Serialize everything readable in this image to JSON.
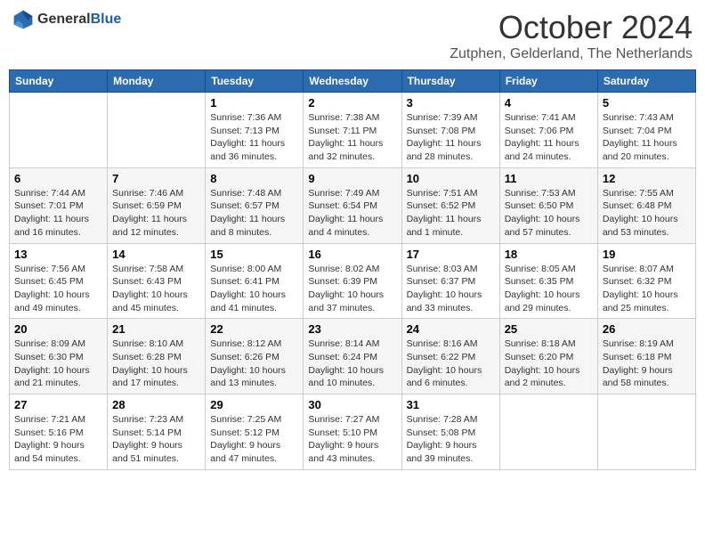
{
  "logo": {
    "general": "General",
    "blue": "Blue"
  },
  "header": {
    "month": "October 2024",
    "location": "Zutphen, Gelderland, The Netherlands"
  },
  "weekdays": [
    "Sunday",
    "Monday",
    "Tuesday",
    "Wednesday",
    "Thursday",
    "Friday",
    "Saturday"
  ],
  "weeks": [
    [
      {
        "day": "",
        "sunrise": "",
        "sunset": "",
        "daylight": ""
      },
      {
        "day": "",
        "sunrise": "",
        "sunset": "",
        "daylight": ""
      },
      {
        "day": "1",
        "sunrise": "Sunrise: 7:36 AM",
        "sunset": "Sunset: 7:13 PM",
        "daylight": "Daylight: 11 hours and 36 minutes."
      },
      {
        "day": "2",
        "sunrise": "Sunrise: 7:38 AM",
        "sunset": "Sunset: 7:11 PM",
        "daylight": "Daylight: 11 hours and 32 minutes."
      },
      {
        "day": "3",
        "sunrise": "Sunrise: 7:39 AM",
        "sunset": "Sunset: 7:08 PM",
        "daylight": "Daylight: 11 hours and 28 minutes."
      },
      {
        "day": "4",
        "sunrise": "Sunrise: 7:41 AM",
        "sunset": "Sunset: 7:06 PM",
        "daylight": "Daylight: 11 hours and 24 minutes."
      },
      {
        "day": "5",
        "sunrise": "Sunrise: 7:43 AM",
        "sunset": "Sunset: 7:04 PM",
        "daylight": "Daylight: 11 hours and 20 minutes."
      }
    ],
    [
      {
        "day": "6",
        "sunrise": "Sunrise: 7:44 AM",
        "sunset": "Sunset: 7:01 PM",
        "daylight": "Daylight: 11 hours and 16 minutes."
      },
      {
        "day": "7",
        "sunrise": "Sunrise: 7:46 AM",
        "sunset": "Sunset: 6:59 PM",
        "daylight": "Daylight: 11 hours and 12 minutes."
      },
      {
        "day": "8",
        "sunrise": "Sunrise: 7:48 AM",
        "sunset": "Sunset: 6:57 PM",
        "daylight": "Daylight: 11 hours and 8 minutes."
      },
      {
        "day": "9",
        "sunrise": "Sunrise: 7:49 AM",
        "sunset": "Sunset: 6:54 PM",
        "daylight": "Daylight: 11 hours and 4 minutes."
      },
      {
        "day": "10",
        "sunrise": "Sunrise: 7:51 AM",
        "sunset": "Sunset: 6:52 PM",
        "daylight": "Daylight: 11 hours and 1 minute."
      },
      {
        "day": "11",
        "sunrise": "Sunrise: 7:53 AM",
        "sunset": "Sunset: 6:50 PM",
        "daylight": "Daylight: 10 hours and 57 minutes."
      },
      {
        "day": "12",
        "sunrise": "Sunrise: 7:55 AM",
        "sunset": "Sunset: 6:48 PM",
        "daylight": "Daylight: 10 hours and 53 minutes."
      }
    ],
    [
      {
        "day": "13",
        "sunrise": "Sunrise: 7:56 AM",
        "sunset": "Sunset: 6:45 PM",
        "daylight": "Daylight: 10 hours and 49 minutes."
      },
      {
        "day": "14",
        "sunrise": "Sunrise: 7:58 AM",
        "sunset": "Sunset: 6:43 PM",
        "daylight": "Daylight: 10 hours and 45 minutes."
      },
      {
        "day": "15",
        "sunrise": "Sunrise: 8:00 AM",
        "sunset": "Sunset: 6:41 PM",
        "daylight": "Daylight: 10 hours and 41 minutes."
      },
      {
        "day": "16",
        "sunrise": "Sunrise: 8:02 AM",
        "sunset": "Sunset: 6:39 PM",
        "daylight": "Daylight: 10 hours and 37 minutes."
      },
      {
        "day": "17",
        "sunrise": "Sunrise: 8:03 AM",
        "sunset": "Sunset: 6:37 PM",
        "daylight": "Daylight: 10 hours and 33 minutes."
      },
      {
        "day": "18",
        "sunrise": "Sunrise: 8:05 AM",
        "sunset": "Sunset: 6:35 PM",
        "daylight": "Daylight: 10 hours and 29 minutes."
      },
      {
        "day": "19",
        "sunrise": "Sunrise: 8:07 AM",
        "sunset": "Sunset: 6:32 PM",
        "daylight": "Daylight: 10 hours and 25 minutes."
      }
    ],
    [
      {
        "day": "20",
        "sunrise": "Sunrise: 8:09 AM",
        "sunset": "Sunset: 6:30 PM",
        "daylight": "Daylight: 10 hours and 21 minutes."
      },
      {
        "day": "21",
        "sunrise": "Sunrise: 8:10 AM",
        "sunset": "Sunset: 6:28 PM",
        "daylight": "Daylight: 10 hours and 17 minutes."
      },
      {
        "day": "22",
        "sunrise": "Sunrise: 8:12 AM",
        "sunset": "Sunset: 6:26 PM",
        "daylight": "Daylight: 10 hours and 13 minutes."
      },
      {
        "day": "23",
        "sunrise": "Sunrise: 8:14 AM",
        "sunset": "Sunset: 6:24 PM",
        "daylight": "Daylight: 10 hours and 10 minutes."
      },
      {
        "day": "24",
        "sunrise": "Sunrise: 8:16 AM",
        "sunset": "Sunset: 6:22 PM",
        "daylight": "Daylight: 10 hours and 6 minutes."
      },
      {
        "day": "25",
        "sunrise": "Sunrise: 8:18 AM",
        "sunset": "Sunset: 6:20 PM",
        "daylight": "Daylight: 10 hours and 2 minutes."
      },
      {
        "day": "26",
        "sunrise": "Sunrise: 8:19 AM",
        "sunset": "Sunset: 6:18 PM",
        "daylight": "Daylight: 9 hours and 58 minutes."
      }
    ],
    [
      {
        "day": "27",
        "sunrise": "Sunrise: 7:21 AM",
        "sunset": "Sunset: 5:16 PM",
        "daylight": "Daylight: 9 hours and 54 minutes."
      },
      {
        "day": "28",
        "sunrise": "Sunrise: 7:23 AM",
        "sunset": "Sunset: 5:14 PM",
        "daylight": "Daylight: 9 hours and 51 minutes."
      },
      {
        "day": "29",
        "sunrise": "Sunrise: 7:25 AM",
        "sunset": "Sunset: 5:12 PM",
        "daylight": "Daylight: 9 hours and 47 minutes."
      },
      {
        "day": "30",
        "sunrise": "Sunrise: 7:27 AM",
        "sunset": "Sunset: 5:10 PM",
        "daylight": "Daylight: 9 hours and 43 minutes."
      },
      {
        "day": "31",
        "sunrise": "Sunrise: 7:28 AM",
        "sunset": "Sunset: 5:08 PM",
        "daylight": "Daylight: 9 hours and 39 minutes."
      },
      {
        "day": "",
        "sunrise": "",
        "sunset": "",
        "daylight": ""
      },
      {
        "day": "",
        "sunrise": "",
        "sunset": "",
        "daylight": ""
      }
    ]
  ]
}
